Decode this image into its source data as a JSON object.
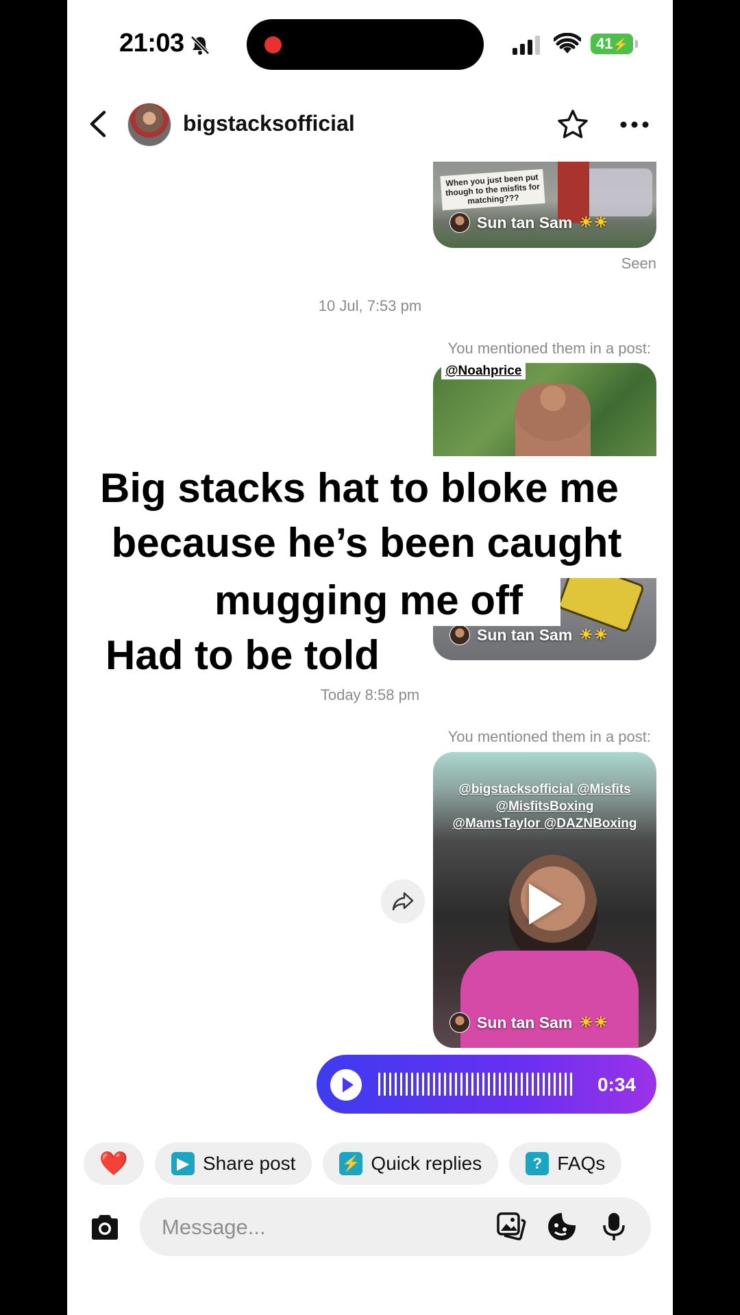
{
  "status": {
    "time": "21:03",
    "battery": "41"
  },
  "header": {
    "username": "bigstacksofficial"
  },
  "messages": {
    "top_thumb": {
      "caption": "When you just been put though to the misfits for matching???",
      "author": "Sun tan Sam",
      "suns": "☀☀"
    },
    "seen": "Seen",
    "timestamp1": "10 Jul, 7:53 pm",
    "mention1": "You mentioned them in a post:",
    "noah_tag": "@Noahprice",
    "mid_author": "Sun tan Sam",
    "timestamp2": "Today 8:58 pm",
    "mention2": "You mentioned them in a post:",
    "main_thumb": {
      "tags_line1": "@bigstacksofficial @Misfits",
      "tags_line2": "@MisfitsBoxing",
      "tags_line3": "@MamsTaylor @DAZNBoxing",
      "author": "Sun tan Sam",
      "suns": "☀☀"
    },
    "voice": {
      "duration": "0:34"
    }
  },
  "overlay": {
    "line1": "Big stacks hat to bloke me",
    "line2": "because he’s been caught",
    "line3": "mugging me off",
    "line4": "Had to be told"
  },
  "chips": {
    "heart": "❤️",
    "share_post": "Share post",
    "quick_replies": "Quick replies",
    "faqs": "FAQs"
  },
  "composer": {
    "placeholder": "Message..."
  },
  "colors": {
    "voice_start": "#3d3cf0",
    "voice_end": "#9b33e8",
    "chip_icon": "#1aa5c3",
    "battery": "#4cc04a"
  }
}
